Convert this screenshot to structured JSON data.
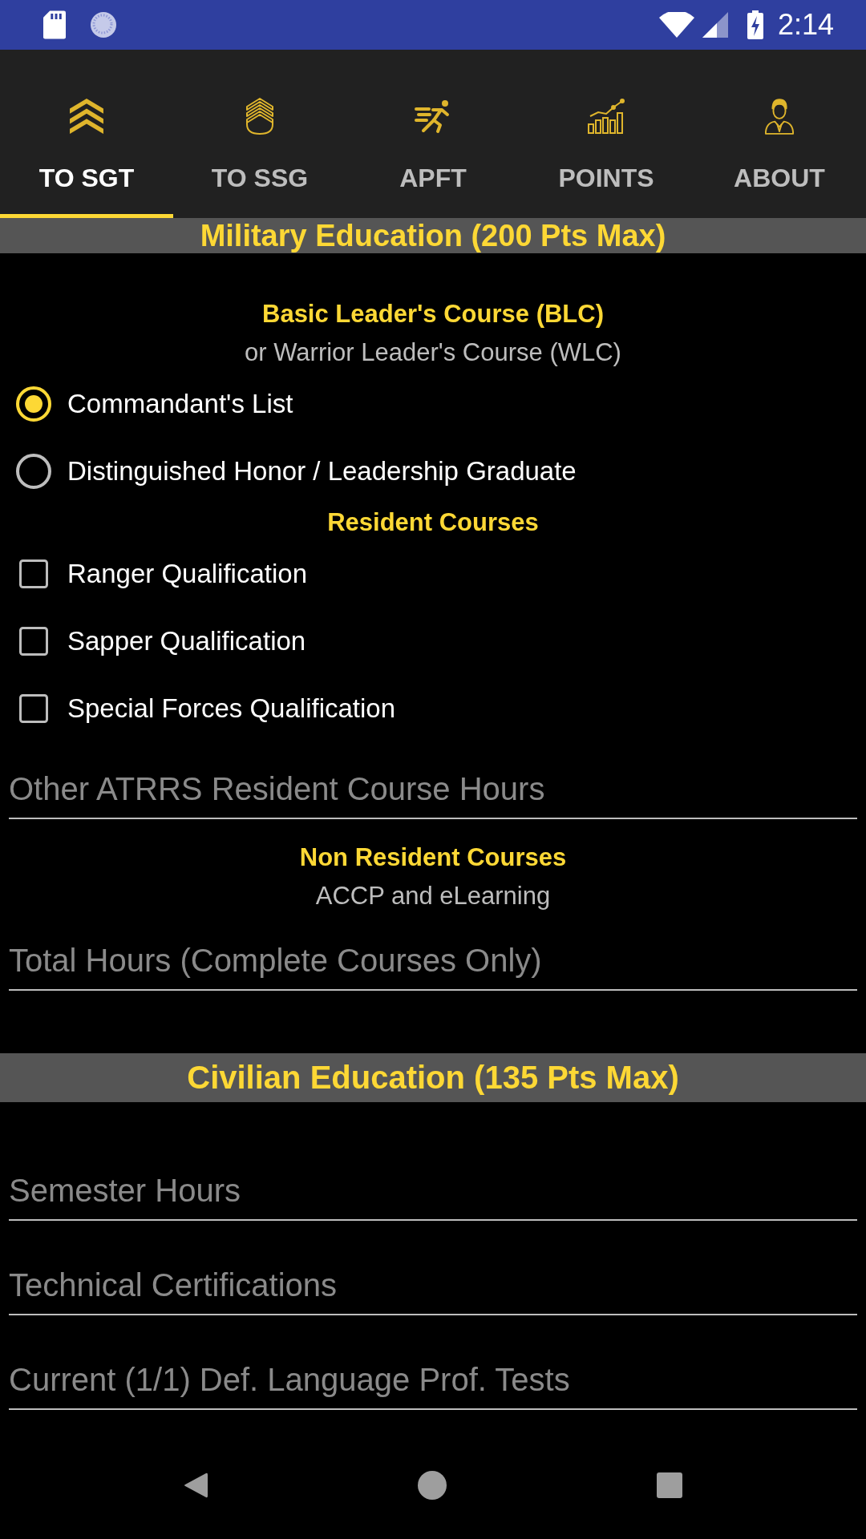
{
  "status_bar": {
    "time": "2:14"
  },
  "tabs": [
    {
      "label": "TO SGT",
      "selected": true
    },
    {
      "label": "TO SSG",
      "selected": false
    },
    {
      "label": "APFT",
      "selected": false
    },
    {
      "label": "POINTS",
      "selected": false
    },
    {
      "label": "ABOUT",
      "selected": false
    }
  ],
  "sections": [
    {
      "title": "Military Education (200 Pts Max)",
      "items": [
        {
          "kind": "heading",
          "text": "Basic Leader's Course (BLC)"
        },
        {
          "kind": "note",
          "text": "or Warrior Leader's Course (WLC)"
        },
        {
          "kind": "radio",
          "label": "Commandant's List",
          "selected": true
        },
        {
          "kind": "radio",
          "label": "Distinguished Honor / Leadership Graduate",
          "selected": false
        },
        {
          "kind": "heading",
          "text": "Resident Courses"
        },
        {
          "kind": "checkbox",
          "label": "Ranger Qualification",
          "checked": false
        },
        {
          "kind": "checkbox",
          "label": "Sapper Qualification",
          "checked": false
        },
        {
          "kind": "checkbox",
          "label": "Special Forces Qualification",
          "checked": false
        },
        {
          "kind": "field",
          "placeholder": "Other ATRRS Resident Course Hours"
        },
        {
          "kind": "heading",
          "text": "Non Resident Courses"
        },
        {
          "kind": "note",
          "text": "ACCP and eLearning"
        },
        {
          "kind": "field",
          "placeholder": "Total Hours (Complete Courses Only)"
        }
      ]
    },
    {
      "title": "Civilian Education (135 Pts Max)",
      "items": [
        {
          "kind": "field",
          "placeholder": "Semester Hours"
        },
        {
          "kind": "field",
          "placeholder": "Technical Certifications"
        },
        {
          "kind": "field",
          "placeholder": "Current (1/1) Def. Language Prof. Tests"
        }
      ]
    }
  ]
}
